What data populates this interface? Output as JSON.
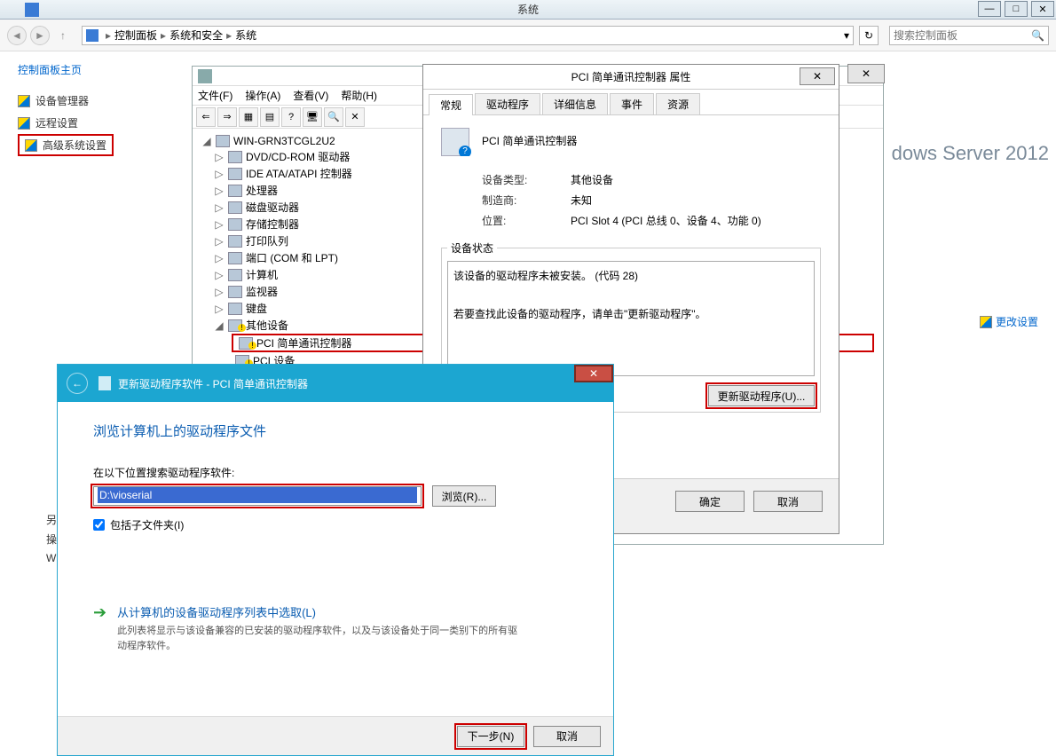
{
  "window": {
    "title": "系统",
    "min": "—",
    "max": "□",
    "close": "✕"
  },
  "breadcrumb": {
    "root_icon": "控制面板",
    "items": [
      "控制面板",
      "系统和安全",
      "系统"
    ],
    "dropdown": "▾",
    "refresh": "↻"
  },
  "search": {
    "placeholder": "搜索控制面板",
    "icon": "🔍"
  },
  "sidebar": {
    "header": "控制面板主页",
    "items": [
      {
        "label": "设备管理器"
      },
      {
        "label": "远程设置"
      },
      {
        "label": "高级系统设置"
      }
    ]
  },
  "change_settings": "更改设置",
  "brand": "dows Server 2012",
  "devmgr": {
    "menu": [
      "文件(F)",
      "操作(A)",
      "查看(V)",
      "帮助(H)"
    ],
    "toolbar_icons": [
      "⇐",
      "⇒",
      "▦",
      "▤",
      "?",
      "🖥",
      "🔍",
      "✕"
    ],
    "root": "WIN-GRN3TCGL2U2",
    "nodes": [
      "DVD/CD-ROM 驱动器",
      "IDE ATA/ATAPI 控制器",
      "处理器",
      "磁盘驱动器",
      "存储控制器",
      "打印队列",
      "端口 (COM 和 LPT)",
      "计算机",
      "监视器",
      "键盘"
    ],
    "other_devices": "其他设备",
    "pci_controller": "PCI 简单通讯控制器",
    "pci_device": "PCI 设备"
  },
  "props": {
    "title": "PCI 简单通讯控制器 属性",
    "close": "✕",
    "tabs": [
      "常规",
      "驱动程序",
      "详细信息",
      "事件",
      "资源"
    ],
    "device_name": "PCI 简单通讯控制器",
    "rows": {
      "type_lbl": "设备类型:",
      "type_val": "其他设备",
      "mfr_lbl": "制造商:",
      "mfr_val": "未知",
      "loc_lbl": "位置:",
      "loc_val": "PCI Slot 4 (PCI 总线 0、设备 4、功能 0)"
    },
    "status_legend": "设备状态",
    "status_line1": "该设备的驱动程序未被安装。 (代码 28)",
    "status_line2": "若要查找此设备的驱动程序，请单击\"更新驱动程序\"。",
    "update_btn": "更新驱动程序(U)...",
    "ok": "确定",
    "cancel": "取消"
  },
  "wizard": {
    "title": "更新驱动程序软件 - PCI 简单通讯控制器",
    "back": "←",
    "close": "✕",
    "heading": "浏览计算机上的驱动程序文件",
    "path_label": "在以下位置搜索驱动程序软件:",
    "path_value": "D:\\vioserial",
    "browse": "浏览(R)...",
    "include_sub": "包括子文件夹(I)",
    "option_title": "从计算机的设备驱动程序列表中选取(L)",
    "option_desc": "此列表将显示与该设备兼容的已安装的驱动程序软件，以及与该设备处于同一类别下的所有驱动程序软件。",
    "next": "下一步(N)",
    "cancel": "取消"
  },
  "peek": {
    "l1": "另",
    "l2": "操",
    "l3": "W"
  }
}
